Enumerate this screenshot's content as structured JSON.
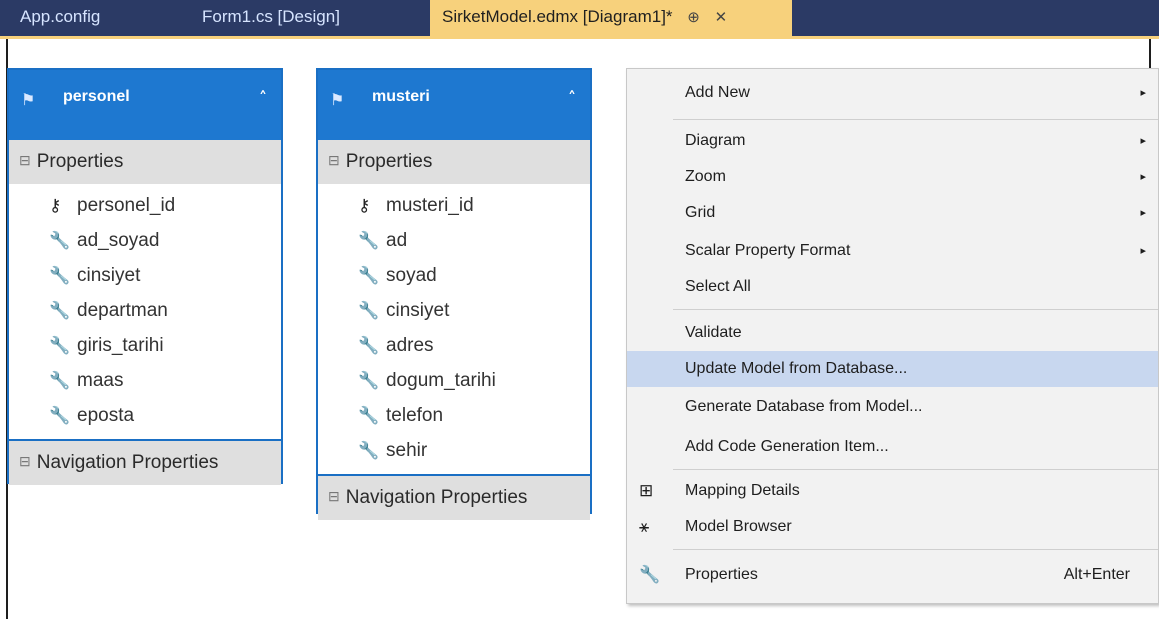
{
  "tabs": [
    {
      "label": "App.config"
    },
    {
      "label": "Form1.cs [Design]"
    },
    {
      "label": "SirketModel.edmx [Diagram1]*",
      "pin": "⊕",
      "close": "✕"
    }
  ],
  "entities": [
    {
      "name": "personel",
      "chevron": "˄",
      "section_properties": "Properties",
      "properties": [
        {
          "name": "personel_id",
          "icon": "key-icon"
        },
        {
          "name": "ad_soyad",
          "icon": "wrench-icon"
        },
        {
          "name": "cinsiyet",
          "icon": "wrench-icon"
        },
        {
          "name": "departman",
          "icon": "wrench-icon"
        },
        {
          "name": "giris_tarihi",
          "icon": "wrench-icon"
        },
        {
          "name": "maas",
          "icon": "wrench-icon"
        },
        {
          "name": "eposta",
          "icon": "wrench-icon"
        }
      ],
      "section_navigation": "Navigation Properties"
    },
    {
      "name": "musteri",
      "chevron": "˄",
      "section_properties": "Properties",
      "properties": [
        {
          "name": "musteri_id",
          "icon": "key-icon"
        },
        {
          "name": "ad",
          "icon": "wrench-icon"
        },
        {
          "name": "soyad",
          "icon": "wrench-icon"
        },
        {
          "name": "cinsiyet",
          "icon": "wrench-icon"
        },
        {
          "name": "adres",
          "icon": "wrench-icon"
        },
        {
          "name": "dogum_tarihi",
          "icon": "wrench-icon"
        },
        {
          "name": "telefon",
          "icon": "wrench-icon"
        },
        {
          "name": "sehir",
          "icon": "wrench-icon"
        }
      ],
      "section_navigation": "Navigation Properties"
    }
  ],
  "context_menu": {
    "items": [
      {
        "label": "Add New",
        "submenu": "▸"
      },
      {
        "label": "Diagram",
        "submenu": "▸"
      },
      {
        "label": "Zoom",
        "submenu": "▸"
      },
      {
        "label": "Grid",
        "submenu": "▸"
      },
      {
        "label": "Scalar Property Format",
        "submenu": "▸"
      },
      {
        "label": "Select All"
      },
      {
        "label": "Validate"
      },
      {
        "label": "Update Model from Database...",
        "highlighted": true
      },
      {
        "label": "Generate Database from Model..."
      },
      {
        "label": "Add Code Generation Item..."
      },
      {
        "label": "Mapping Details",
        "icon": "mapping-details-icon"
      },
      {
        "label": "Model Browser",
        "icon": "model-browser-icon"
      },
      {
        "label": "Properties",
        "icon": "wrench-icon",
        "shortcut": "Alt+Enter"
      }
    ]
  },
  "colors": {
    "tabbar": "#2b3a65",
    "active_tab": "#f7d17c",
    "entity_header": "#1e78d0",
    "menu_highlight": "#c8d7ef"
  }
}
